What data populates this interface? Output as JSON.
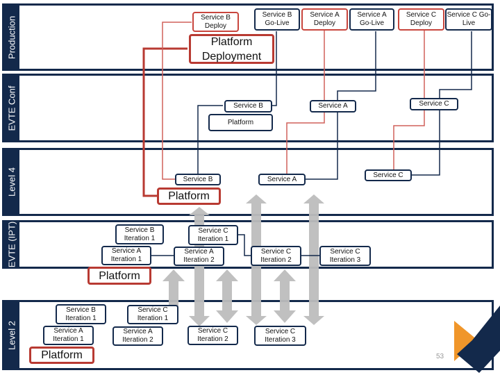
{
  "lanes": [
    "Production",
    "EVTE Conf",
    "Level 4",
    "EVTE (IPT)",
    "Level 2"
  ],
  "production": {
    "b_deploy": "Service B Deploy",
    "b_golive": "Service B Go-Live",
    "a_deploy": "Service A Deploy",
    "a_golive": "Service A Go-Live",
    "c_deploy": "Service C Deploy",
    "c_golive": "Service C Go-Live",
    "platform": "Platform Deployment"
  },
  "evte_conf": {
    "b": "Service B",
    "a": "Service A",
    "c": "Service C",
    "platform": "Platform"
  },
  "level4": {
    "b": "Service B",
    "a": "Service A",
    "c": "Service C",
    "platform": "Platform"
  },
  "ipt": {
    "b1": "Service B Iteration 1",
    "c1": "Service C Iteration 1",
    "a1": "Service A Iteration 1",
    "a2": "Service A Iteration 2",
    "c2": "Service C Iteration 2",
    "c3": "Service C Iteration 3",
    "platform": "Platform"
  },
  "level2": {
    "b1": "Service B Iteration 1",
    "c1": "Service C Iteration 1",
    "a1": "Service A Iteration 1",
    "a2": "Service A Iteration 2",
    "c2": "Service C Iteration 2",
    "c3": "Service C Iteration 3",
    "platform": "Platform"
  },
  "page_number": "53",
  "colors": {
    "navy": "#13294b",
    "red": "#c8453d",
    "orange": "#f0962a",
    "arrow": "#bdbdbd"
  }
}
